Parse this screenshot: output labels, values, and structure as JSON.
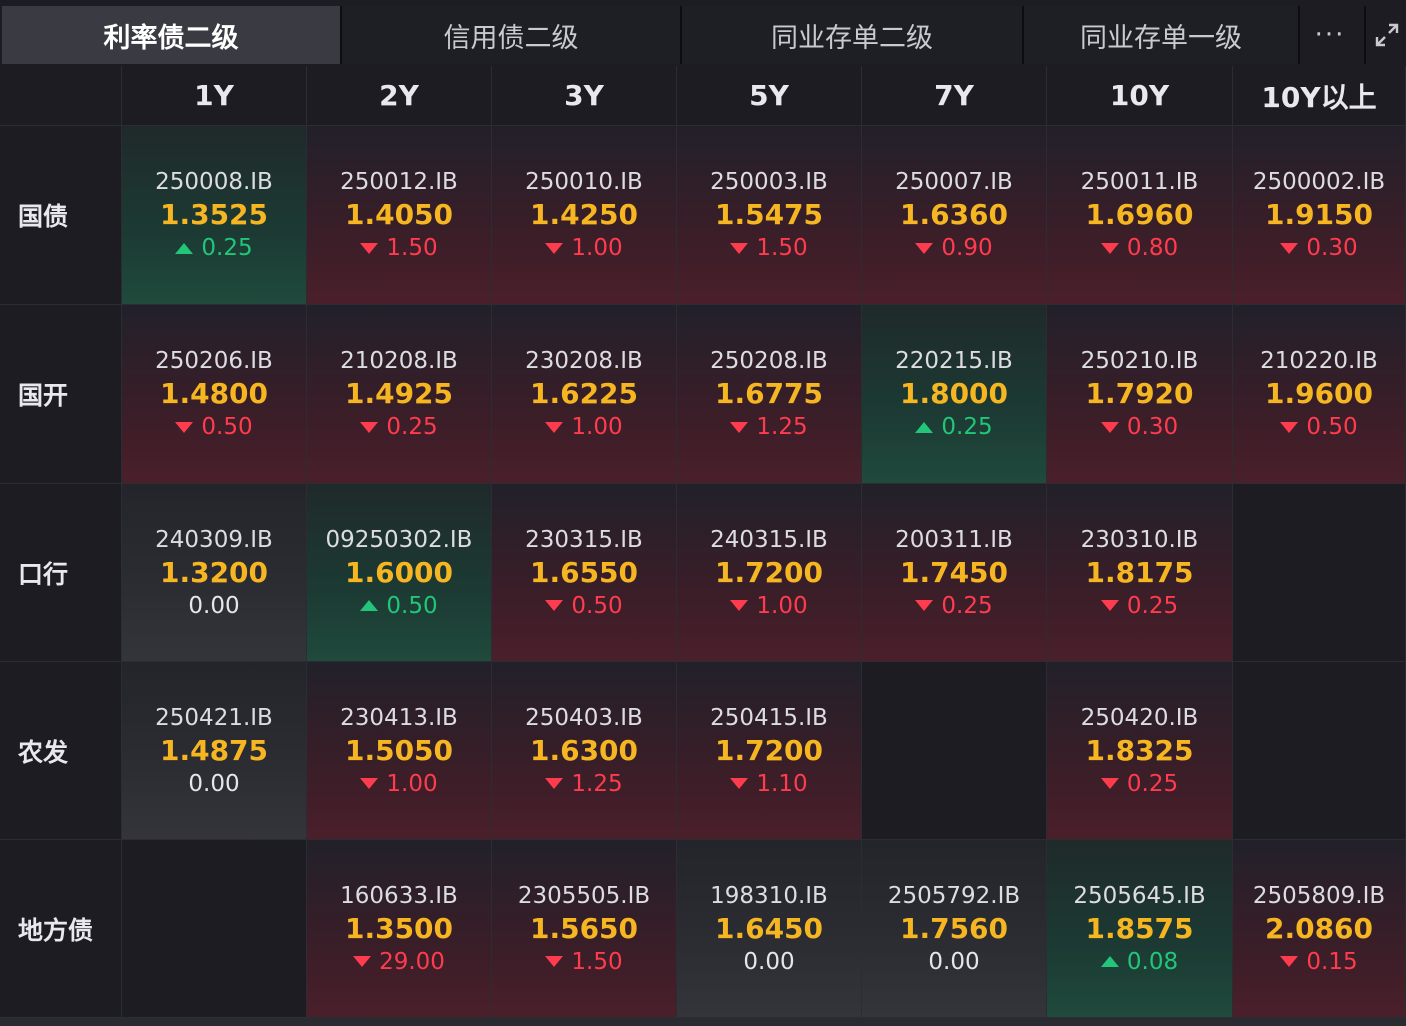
{
  "tabs": [
    {
      "label": "利率债二级",
      "active": true
    },
    {
      "label": "信用债二级",
      "active": false
    },
    {
      "label": "同业存单二级",
      "active": false
    },
    {
      "label": "同业存单一级",
      "active": false
    }
  ],
  "more_label": "···",
  "columns": [
    "1Y",
    "2Y",
    "3Y",
    "5Y",
    "7Y",
    "10Y",
    "10Y以上"
  ],
  "rows": [
    {
      "label": "国债",
      "cells": [
        {
          "code": "250008.IB",
          "rate": "1.3525",
          "dir": "up",
          "change": "0.25"
        },
        {
          "code": "250012.IB",
          "rate": "1.4050",
          "dir": "down",
          "change": "1.50"
        },
        {
          "code": "250010.IB",
          "rate": "1.4250",
          "dir": "down",
          "change": "1.00"
        },
        {
          "code": "250003.IB",
          "rate": "1.5475",
          "dir": "down",
          "change": "1.50"
        },
        {
          "code": "250007.IB",
          "rate": "1.6360",
          "dir": "down",
          "change": "0.90"
        },
        {
          "code": "250011.IB",
          "rate": "1.6960",
          "dir": "down",
          "change": "0.80"
        },
        {
          "code": "2500002.IB",
          "rate": "1.9150",
          "dir": "down",
          "change": "0.30"
        }
      ]
    },
    {
      "label": "国开",
      "cells": [
        {
          "code": "250206.IB",
          "rate": "1.4800",
          "dir": "down",
          "change": "0.50"
        },
        {
          "code": "210208.IB",
          "rate": "1.4925",
          "dir": "down",
          "change": "0.25"
        },
        {
          "code": "230208.IB",
          "rate": "1.6225",
          "dir": "down",
          "change": "1.00"
        },
        {
          "code": "250208.IB",
          "rate": "1.6775",
          "dir": "down",
          "change": "1.25"
        },
        {
          "code": "220215.IB",
          "rate": "1.8000",
          "dir": "up",
          "change": "0.25"
        },
        {
          "code": "250210.IB",
          "rate": "1.7920",
          "dir": "down",
          "change": "0.30"
        },
        {
          "code": "210220.IB",
          "rate": "1.9600",
          "dir": "down",
          "change": "0.50"
        }
      ]
    },
    {
      "label": "口行",
      "cells": [
        {
          "code": "240309.IB",
          "rate": "1.3200",
          "dir": "flat",
          "change": "0.00"
        },
        {
          "code": "09250302.IB",
          "rate": "1.6000",
          "dir": "up",
          "change": "0.50"
        },
        {
          "code": "230315.IB",
          "rate": "1.6550",
          "dir": "down",
          "change": "0.50"
        },
        {
          "code": "240315.IB",
          "rate": "1.7200",
          "dir": "down",
          "change": "1.00"
        },
        {
          "code": "200311.IB",
          "rate": "1.7450",
          "dir": "down",
          "change": "0.25"
        },
        {
          "code": "230310.IB",
          "rate": "1.8175",
          "dir": "down",
          "change": "0.25"
        },
        null
      ]
    },
    {
      "label": "农发",
      "cells": [
        {
          "code": "250421.IB",
          "rate": "1.4875",
          "dir": "flat",
          "change": "0.00"
        },
        {
          "code": "230413.IB",
          "rate": "1.5050",
          "dir": "down",
          "change": "1.00"
        },
        {
          "code": "250403.IB",
          "rate": "1.6300",
          "dir": "down",
          "change": "1.25"
        },
        {
          "code": "250415.IB",
          "rate": "1.7200",
          "dir": "down",
          "change": "1.10"
        },
        null,
        {
          "code": "250420.IB",
          "rate": "1.8325",
          "dir": "down",
          "change": "0.25"
        },
        null
      ]
    },
    {
      "label": "地方债",
      "cells": [
        null,
        {
          "code": "160633.IB",
          "rate": "1.3500",
          "dir": "down",
          "change": "29.00"
        },
        {
          "code": "2305505.IB",
          "rate": "1.5650",
          "dir": "down",
          "change": "1.50"
        },
        {
          "code": "198310.IB",
          "rate": "1.6450",
          "dir": "flat",
          "change": "0.00"
        },
        {
          "code": "2505792.IB",
          "rate": "1.7560",
          "dir": "flat",
          "change": "0.00"
        },
        {
          "code": "2505645.IB",
          "rate": "1.8575",
          "dir": "up",
          "change": "0.08"
        },
        {
          "code": "2505809.IB",
          "rate": "2.0860",
          "dir": "down",
          "change": "0.15"
        }
      ]
    }
  ],
  "colors": {
    "accent": "#f5b622",
    "down": "#ff3b4e",
    "up": "#22c57a"
  }
}
